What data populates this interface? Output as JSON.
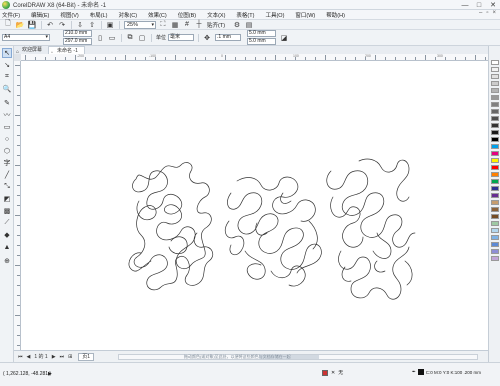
{
  "window": {
    "title": "CorelDRAW X8 (64-Bit) - 未命名 -1",
    "min": "—",
    "max": "□",
    "close": "✕"
  },
  "menu": {
    "items": [
      "文件(F)",
      "编辑(E)",
      "视图(V)",
      "布局(L)",
      "对象(C)",
      "效果(C)",
      "位图(B)",
      "文本(X)",
      "表格(T)",
      "工具(O)",
      "窗口(W)",
      "帮助(H)"
    ]
  },
  "toolbar": {
    "zoom_value": "25%",
    "snap_label": "贴齐(T)"
  },
  "property_bar": {
    "page_size": "A4",
    "width": "210.0 mm",
    "height": "297.0 mm",
    "units_label": "单位",
    "units_value": "毫米",
    "nudge": ".1 mm",
    "dup_x": "5.0 mm",
    "dup_y": "5.0 mm"
  },
  "tabs": {
    "welcome": "欢迎屏幕",
    "document": "未命名 -1"
  },
  "ruler": {
    "h_numbers": [
      "-200",
      "-100",
      "0",
      "100",
      "200",
      "300",
      "400"
    ]
  },
  "pagebar": {
    "page_count": "1 的 1",
    "page_tab": "页1",
    "hint": "拖动颜色(或对象)至此处，以便将这些颜色与文档存储在一起"
  },
  "statusbar": {
    "coords": "( 1,262.128, -48.281 )",
    "arrow": "▶",
    "fill_label": "无",
    "outline_label": "C:0 M:0 Y:0 K:100  .200 mm"
  },
  "colors": {
    "accent": "#4a7ab5"
  },
  "palette_colors": [
    "#ffffff",
    "#f2f2f2",
    "#e0e0e0",
    "#cccccc",
    "#b3b3b3",
    "#999999",
    "#808080",
    "#666666",
    "#4d4d4d",
    "#333333",
    "#1a1a1a",
    "#000000",
    "#00a0e9",
    "#e4007f",
    "#fff100",
    "#ff0000",
    "#ff7f00",
    "#00a650",
    "#2e3192",
    "#662d91",
    "#c69c6d",
    "#8c6239",
    "#754c24",
    "#9fc9a4",
    "#b3d7ef",
    "#7fb2e5",
    "#5c8ad6",
    "#8e8ed6",
    "#c2a5d8"
  ]
}
